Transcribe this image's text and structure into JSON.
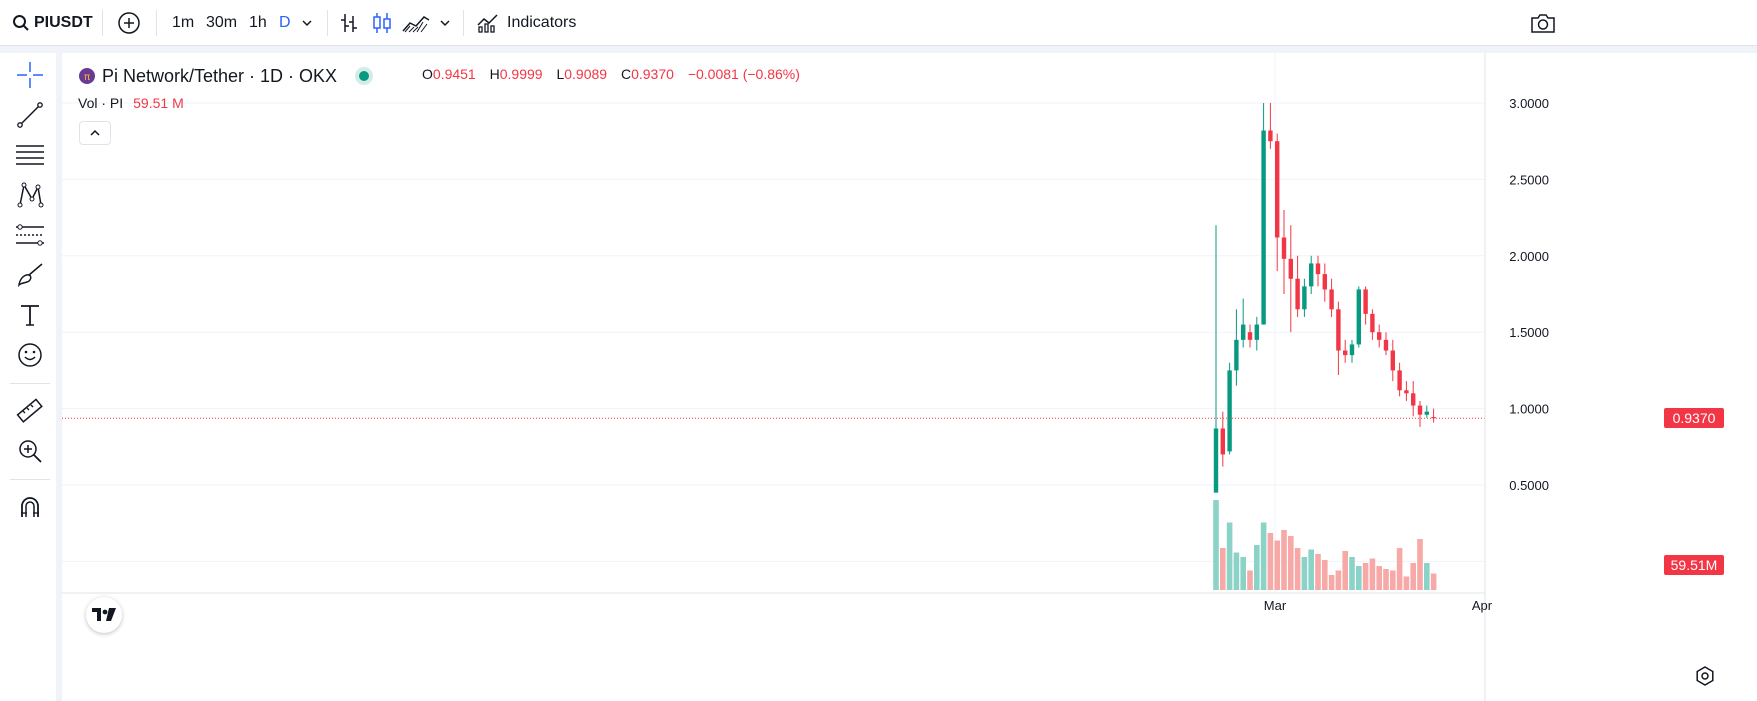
{
  "topbar": {
    "symbol": "PIUSDT",
    "intervals": [
      "1m",
      "30m",
      "1h",
      "D"
    ],
    "active_interval": "D",
    "indicators_label": "Indicators"
  },
  "legend": {
    "title": "Pi Network/Tether · 1D · OKX",
    "o_label": "O",
    "o_value": "0.9451",
    "h_label": "H",
    "h_value": "0.9999",
    "l_label": "L",
    "l_value": "0.9089",
    "c_label": "C",
    "c_value": "0.9370",
    "change": "−0.0081 (−0.86%)",
    "vol_label": "Vol · PI",
    "vol_value": "59.51 M"
  },
  "colors": {
    "up": "#089981",
    "down": "#f23645",
    "vol_up": "#8cd3c7",
    "vol_down": "#f7a9a7",
    "active": "#2962ff"
  },
  "chart_data": {
    "type": "candlestick",
    "symbol": "PIUSDT",
    "y_axis_ticks": [
      "3.0000",
      "2.5000",
      "2.0000",
      "1.5000",
      "1.0000",
      "0.5000"
    ],
    "ylim": [
      0.0,
      3.1
    ],
    "x_axis_ticks": [
      "Mar",
      "Apr"
    ],
    "last_price": "0.9370",
    "last_volume": "59.51M",
    "candles": [
      {
        "o": 0.45,
        "h": 2.2,
        "l": 0.45,
        "c": 0.87
      },
      {
        "o": 0.87,
        "h": 0.98,
        "l": 0.62,
        "c": 0.7
      },
      {
        "o": 0.72,
        "h": 1.3,
        "l": 0.7,
        "c": 1.25
      },
      {
        "o": 1.25,
        "h": 1.65,
        "l": 1.15,
        "c": 1.45
      },
      {
        "o": 1.45,
        "h": 1.72,
        "l": 1.4,
        "c": 1.55
      },
      {
        "o": 1.5,
        "h": 1.55,
        "l": 1.4,
        "c": 1.45
      },
      {
        "o": 1.45,
        "h": 1.6,
        "l": 1.38,
        "c": 1.55
      },
      {
        "o": 1.55,
        "h": 3.0,
        "l": 1.55,
        "c": 2.82
      },
      {
        "o": 2.82,
        "h": 3.0,
        "l": 2.7,
        "c": 2.75
      },
      {
        "o": 2.75,
        "h": 2.8,
        "l": 1.9,
        "c": 2.12
      },
      {
        "o": 2.12,
        "h": 2.3,
        "l": 1.75,
        "c": 1.98
      },
      {
        "o": 1.98,
        "h": 2.2,
        "l": 1.5,
        "c": 1.85
      },
      {
        "o": 1.85,
        "h": 2.0,
        "l": 1.6,
        "c": 1.65
      },
      {
        "o": 1.65,
        "h": 1.85,
        "l": 1.6,
        "c": 1.8
      },
      {
        "o": 1.8,
        "h": 2.0,
        "l": 1.75,
        "c": 1.95
      },
      {
        "o": 1.95,
        "h": 2.0,
        "l": 1.8,
        "c": 1.88
      },
      {
        "o": 1.88,
        "h": 1.95,
        "l": 1.7,
        "c": 1.78
      },
      {
        "o": 1.78,
        "h": 1.85,
        "l": 1.6,
        "c": 1.65
      },
      {
        "o": 1.65,
        "h": 1.7,
        "l": 1.22,
        "c": 1.38
      },
      {
        "o": 1.38,
        "h": 1.45,
        "l": 1.3,
        "c": 1.35
      },
      {
        "o": 1.35,
        "h": 1.45,
        "l": 1.3,
        "c": 1.42
      },
      {
        "o": 1.42,
        "h": 1.8,
        "l": 1.4,
        "c": 1.78
      },
      {
        "o": 1.78,
        "h": 1.8,
        "l": 1.55,
        "c": 1.62
      },
      {
        "o": 1.62,
        "h": 1.65,
        "l": 1.45,
        "c": 1.5
      },
      {
        "o": 1.5,
        "h": 1.55,
        "l": 1.4,
        "c": 1.45
      },
      {
        "o": 1.45,
        "h": 1.5,
        "l": 1.35,
        "c": 1.38
      },
      {
        "o": 1.38,
        "h": 1.45,
        "l": 1.18,
        "c": 1.25
      },
      {
        "o": 1.25,
        "h": 1.3,
        "l": 1.08,
        "c": 1.12
      },
      {
        "o": 1.12,
        "h": 1.18,
        "l": 1.05,
        "c": 1.1
      },
      {
        "o": 1.1,
        "h": 1.18,
        "l": 0.95,
        "c": 1.02
      },
      {
        "o": 1.02,
        "h": 1.05,
        "l": 0.88,
        "c": 0.96
      },
      {
        "o": 0.96,
        "h": 1.02,
        "l": 0.94,
        "c": 0.98
      },
      {
        "o": 0.9451,
        "h": 0.9999,
        "l": 0.9089,
        "c": 0.937
      }
    ],
    "volume_scale": [
      0,
      100
    ],
    "volumes": [
      60,
      28,
      45,
      25,
      22,
      13,
      30,
      45,
      38,
      33,
      40,
      36,
      28,
      22,
      27,
      24,
      20,
      10,
      13,
      26,
      22,
      16,
      18,
      21,
      16,
      14,
      13,
      28,
      9,
      18,
      34,
      18,
      11
    ]
  }
}
